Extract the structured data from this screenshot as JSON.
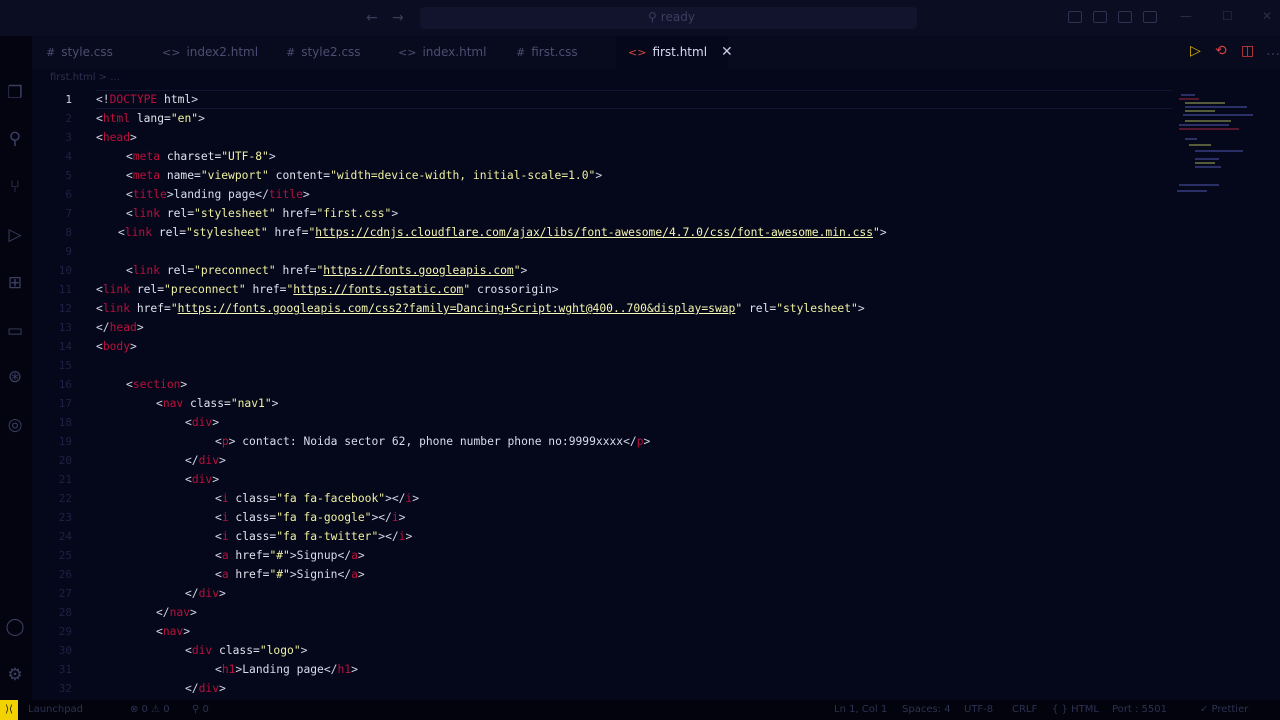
{
  "titlebar": {
    "search_placeholder": "ready",
    "search_icon": "search-icon",
    "back_icon": "arrow-left-icon",
    "forward_icon": "arrow-right-icon"
  },
  "tabs": [
    {
      "label": "style.css",
      "type_icon": "#"
    },
    {
      "label": "index2.html",
      "type_icon": "<>"
    },
    {
      "label": "style2.css",
      "type_icon": "#"
    },
    {
      "label": "index.html",
      "type_icon": "<>"
    },
    {
      "label": "first.css",
      "type_icon": "#"
    },
    {
      "label": "first.html",
      "type_icon": "<>",
      "active": true,
      "close": "✕"
    }
  ],
  "breadcrumb": "first.html > ...",
  "editor": {
    "active_line": 1,
    "visible_lines": 32
  },
  "code": {
    "l8_url": "https://cdnjs.cloudflare.com/ajax/libs/font-awesome/4.7.0/css/font-awesome.min.css",
    "l10_url": "https://fonts.googleapis.com",
    "l11_url": "https://fonts.gstatic.com",
    "l12_url": "https://fonts.googleapis.com/css2?family=Dancing+Script:wght@400..700&display=swap",
    "contact": "contact: Noida sector 62, phone number phone no:9999xxxx",
    "signup": "Signup",
    "signin": "Signin",
    "landing": "Landing page",
    "title": "landing page"
  },
  "statusbar": {
    "live_server": "Launchpad",
    "problems": "⊗ 0 ⚠ 0",
    "ports": "⚲ 0",
    "position": "Ln 1, Col 1",
    "spaces": "Spaces: 4",
    "encoding": "UTF-8",
    "eol": "CRLF",
    "language": "{ } HTML",
    "port": "Port : 5501",
    "prettier": "✓ Prettier"
  },
  "colors": {
    "background": "#05071a",
    "tag": "#b8113d",
    "string": "#eef0a0",
    "remote_badge": "#f2d200"
  }
}
